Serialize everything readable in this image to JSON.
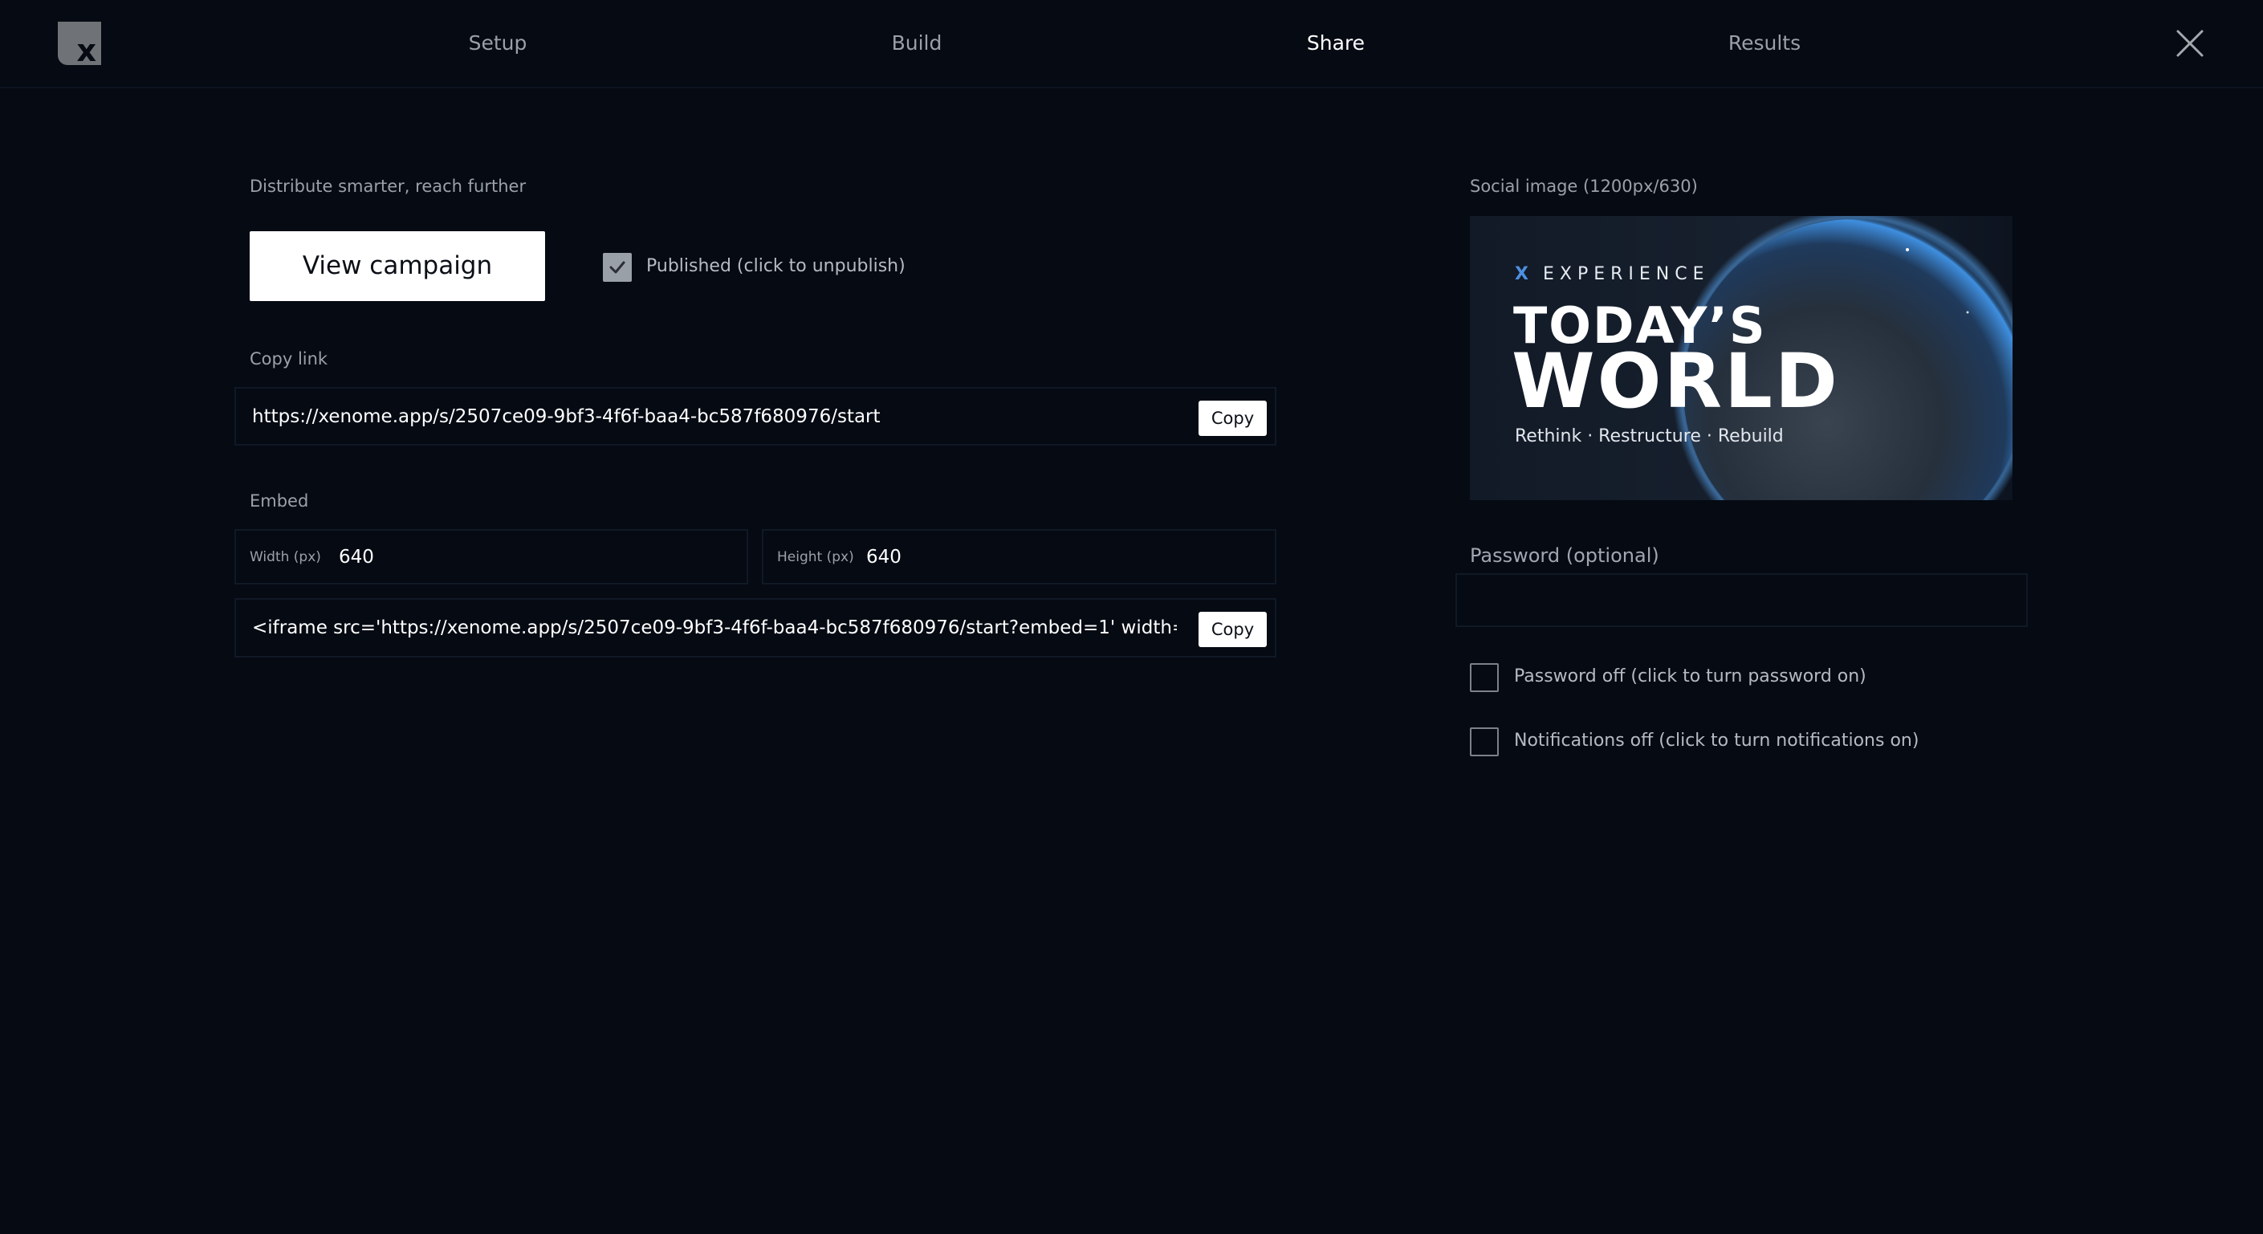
{
  "logo": {
    "letter": "x"
  },
  "nav": {
    "tabs": [
      {
        "label": "Setup",
        "active": false
      },
      {
        "label": "Build",
        "active": false
      },
      {
        "label": "Share",
        "active": true
      },
      {
        "label": "Results",
        "active": false
      }
    ],
    "close_icon": "close-icon"
  },
  "share": {
    "tagline": "Distribute smarter, reach further",
    "view_campaign_label": "View campaign",
    "published": {
      "checked": true,
      "label": "Published (click to unpublish)"
    },
    "copy_link": {
      "label": "Copy link",
      "url": "https://xenome.app/s/2507ce09-9bf3-4f6f-baa4-bc587f680976/start",
      "copy_label": "Copy"
    },
    "embed": {
      "label": "Embed",
      "width_label": "Width (px)",
      "width_value": "640",
      "height_label": "Height (px)",
      "height_value": "640",
      "code": "<iframe src='https://xenome.app/s/2507ce09-9bf3-4f6f-baa4-bc587f680976/start?embed=1' width='...",
      "copy_label": "Copy"
    }
  },
  "social": {
    "label": "Social image (1200px/630)",
    "image": {
      "brand_x": "X",
      "brand_text": "EXPERIENCE",
      "title_line1": "TODAY’S",
      "title_line2": "WORLD",
      "subtitle": "Rethink · Restructure · Rebuild"
    }
  },
  "password": {
    "label": "Password (optional)",
    "value": "",
    "toggle": {
      "checked": false,
      "label": "Password off (click to turn password on)"
    }
  },
  "notifications": {
    "toggle": {
      "checked": false,
      "label": "Notifications off (click to turn notifications on)"
    }
  },
  "colors": {
    "background": "#050a13",
    "button_bg": "#ffffff",
    "muted_text": "#9ba1a9",
    "brand_blue": "#4d8fe0",
    "checkbox_checked": "#9aa0a7"
  }
}
